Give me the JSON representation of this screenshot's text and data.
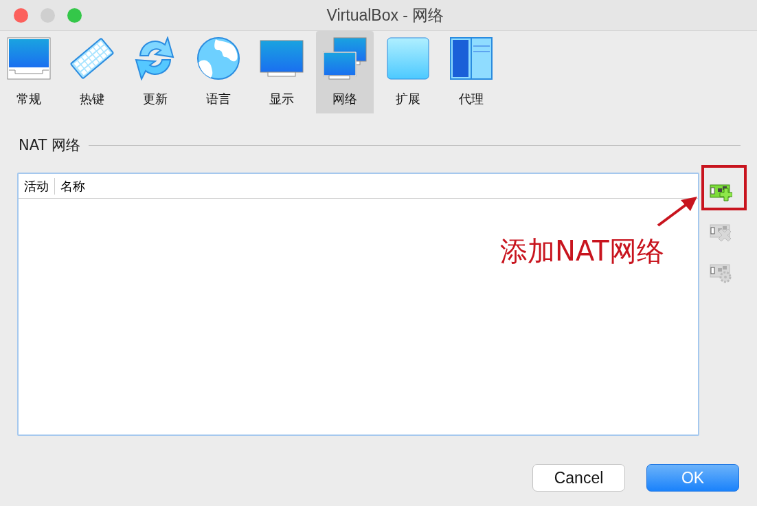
{
  "window": {
    "title": "VirtualBox - 网络"
  },
  "tabs": [
    {
      "label": "常规",
      "kind": "general",
      "selected": false
    },
    {
      "label": "热键",
      "kind": "keyboard",
      "selected": false
    },
    {
      "label": "更新",
      "kind": "update",
      "selected": false
    },
    {
      "label": "语言",
      "kind": "globe",
      "selected": false
    },
    {
      "label": "显示",
      "kind": "display",
      "selected": false
    },
    {
      "label": "网络",
      "kind": "network",
      "selected": true
    },
    {
      "label": "扩展",
      "kind": "extension",
      "selected": false
    },
    {
      "label": "代理",
      "kind": "proxy",
      "selected": false
    }
  ],
  "section": {
    "title": "NAT 网络"
  },
  "table": {
    "columns": [
      "活动",
      "名称"
    ]
  },
  "side_buttons": [
    {
      "kind": "add",
      "disabled": false
    },
    {
      "kind": "remove",
      "disabled": true
    },
    {
      "kind": "edit",
      "disabled": true
    }
  ],
  "annotation": {
    "text": "添加NAT网络"
  },
  "buttons": [
    {
      "label": "Cancel",
      "kind": "cancel"
    },
    {
      "label": "OK",
      "kind": "ok"
    }
  ]
}
